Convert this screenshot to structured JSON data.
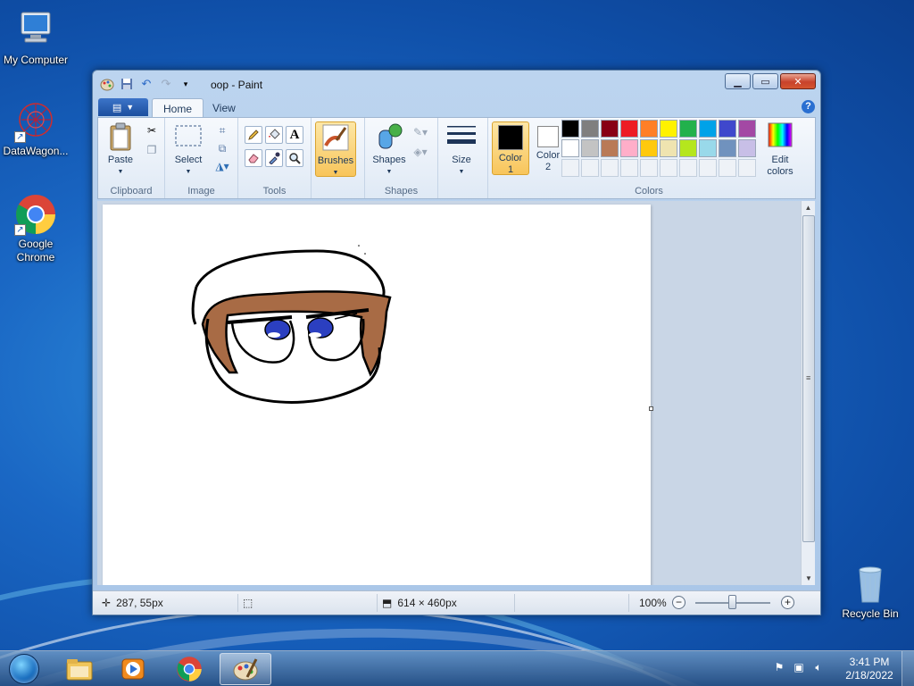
{
  "desktop": {
    "icons": [
      {
        "label": "My Computer",
        "icon": "computer-icon"
      },
      {
        "label": "DataWagon...",
        "icon": "datawagon-icon"
      },
      {
        "label": "Google Chrome",
        "icon": "chrome-icon"
      },
      {
        "label": "Recycle Bin",
        "icon": "recycle-bin-icon"
      }
    ]
  },
  "window": {
    "title": "oop - Paint",
    "tabs": {
      "home": "Home",
      "view": "View"
    },
    "ribbon": {
      "clipboard": {
        "paste": "Paste",
        "label": "Clipboard"
      },
      "image": {
        "select": "Select",
        "label": "Image"
      },
      "tools": {
        "label": "Tools"
      },
      "brushes": {
        "label": "Brushes"
      },
      "shapes": {
        "shapes": "Shapes",
        "label": "Shapes"
      },
      "size": {
        "label": "Size"
      },
      "colors": {
        "color1_line1": "Color",
        "color1_line2": "1",
        "color2_line1": "Color",
        "color2_line2": "2",
        "edit_line1": "Edit",
        "edit_line2": "colors",
        "label": "Colors",
        "color1": "#000000",
        "color2": "#ffffff",
        "palette": [
          "#000000",
          "#7f7f7f",
          "#880015",
          "#ed1c24",
          "#ff7f27",
          "#fff200",
          "#22b14c",
          "#00a2e8",
          "#3f48cc",
          "#a349a4",
          "#ffffff",
          "#c3c3c3",
          "#b97a57",
          "#ffaec9",
          "#ffc90e",
          "#efe4b0",
          "#b5e61d",
          "#99d9ea",
          "#7092be",
          "#c8bfe7"
        ]
      }
    },
    "status": {
      "cursor_pos": "287, 55px",
      "image_size": "614 × 460px",
      "zoom": "100%"
    }
  },
  "taskbar": {
    "items": [
      "explorer-icon",
      "media-player-icon",
      "chrome-icon",
      "paint-icon"
    ],
    "time": "3:41 PM",
    "date": "2/18/2022"
  }
}
